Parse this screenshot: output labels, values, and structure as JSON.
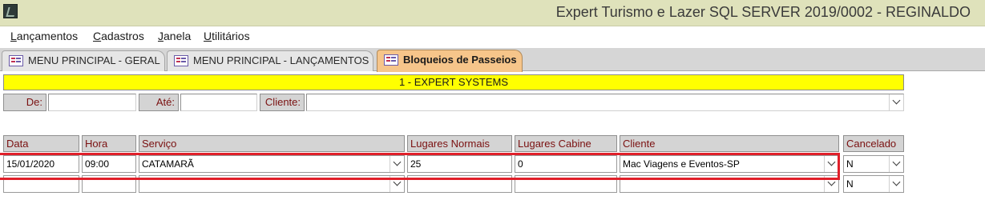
{
  "window": {
    "title": "Expert Turismo e Lazer SQL SERVER 2019/0002 - REGINALDO"
  },
  "menu": [
    {
      "label": "Lançamentos",
      "hotkey": "L",
      "rest": "ançamentos"
    },
    {
      "label": "Cadastros",
      "hotkey": "C",
      "rest": "adastros"
    },
    {
      "label": "Janela",
      "hotkey": "J",
      "rest": "anela"
    },
    {
      "label": "Utilitários",
      "hotkey": "U",
      "rest": "tilitários"
    }
  ],
  "tabs": [
    {
      "label": "MENU PRINCIPAL - GERAL",
      "icon": "form-icon",
      "active": false
    },
    {
      "label": "MENU PRINCIPAL - LANÇAMENTOS",
      "icon": "form-icon",
      "active": false
    },
    {
      "label": "Bloqueios de Passeios",
      "icon": "form-icon",
      "active": true
    }
  ],
  "form": {
    "company": "1 - EXPERT SYSTEMS",
    "filters": {
      "de_label": "De:",
      "de_value": "",
      "ate_label": "Até:",
      "ate_value": "",
      "cliente_label": "Cliente:",
      "cliente_value": ""
    }
  },
  "grid": {
    "columns": [
      "Data",
      "Hora",
      "Serviço",
      "Lugares Normais",
      "Lugares Cabine",
      "Cliente",
      "Cancelado"
    ],
    "rows": [
      {
        "data": "15/01/2020",
        "hora": "09:00",
        "servico": "CATAMARÃ",
        "lugares_normais": "25",
        "lugares_cabine": "0",
        "cliente": "Mac Viagens e Eventos-SP",
        "cancelado": "N"
      },
      {
        "data": "",
        "hora": "",
        "servico": "",
        "lugares_normais": "",
        "lugares_cabine": "",
        "cliente": "",
        "cancelado": "N"
      }
    ]
  },
  "colors": {
    "titlebar": "#dfe2bb",
    "banner": "#ffff00",
    "active_tab": "#f6c58a",
    "label_text": "#7a1010",
    "highlight": "#e0202a"
  }
}
